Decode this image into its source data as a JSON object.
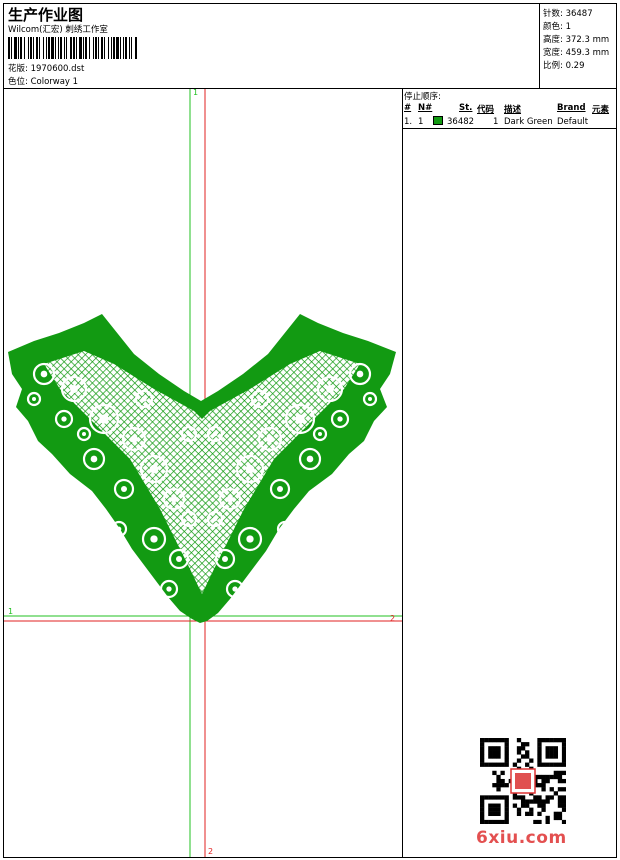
{
  "header": {
    "title": "生产作业图",
    "company": "Wilcom(汇宏) 刺绣工作室",
    "design_label": "花版: 1970600.dst",
    "colorway_label": "色位: Colorway 1"
  },
  "stats": [
    {
      "label": "针数: 36487"
    },
    {
      "label": "颜色: 1"
    },
    {
      "label": "高度: 372.3 mm"
    },
    {
      "label": "宽度: 459.3 mm"
    },
    {
      "label": "比例: 0.29"
    }
  ],
  "stop_sequence": {
    "title": "停止顺序:",
    "headers": [
      "#",
      "N#",
      "St.",
      "代码",
      "描述",
      "Brand",
      "元素"
    ],
    "rows": [
      {
        "num": "1.",
        "n": "1",
        "color": "#129a12",
        "stitches": "36482",
        "code": "1",
        "desc": "Dark Green",
        "brand": "Default",
        "element": ""
      }
    ]
  },
  "axes": {
    "green_label_top": "1",
    "green_label_left": "1",
    "red_label_right": "2",
    "red_label_bottom": "2"
  },
  "colors": {
    "embroidery": "#129a12",
    "axis_green": "#22c022",
    "axis_red": "#e02020"
  },
  "watermark": "6xiu.com"
}
